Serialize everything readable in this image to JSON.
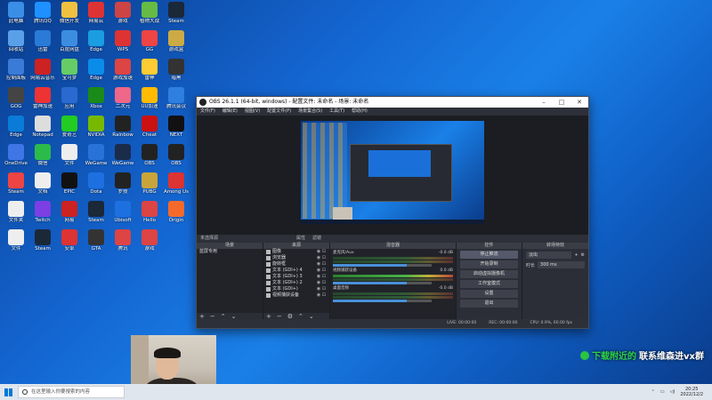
{
  "desktop_icons": [
    {
      "label": "此电脑",
      "color": "#3a8ee6"
    },
    {
      "label": "腾讯QQ",
      "color": "#1e90ff"
    },
    {
      "label": "微信开发",
      "color": "#f0c040"
    },
    {
      "label": "网易云",
      "color": "#d33"
    },
    {
      "label": "游戏",
      "color": "#c44"
    },
    {
      "label": "植物大战",
      "color": "#6b4"
    },
    {
      "label": "Steam",
      "color": "#1b2838"
    },
    {
      "label": "回收站",
      "color": "#5aa0e8"
    },
    {
      "label": "迅雷",
      "color": "#2a7ad8"
    },
    {
      "label": "百度网盘",
      "color": "#3c8de0"
    },
    {
      "label": "Edge",
      "color": "#1b9de2"
    },
    {
      "label": "WPS",
      "color": "#d33"
    },
    {
      "label": "GG",
      "color": "#e44"
    },
    {
      "label": "游戏盒",
      "color": "#ca4"
    },
    {
      "label": "控制面板",
      "color": "#3b7bd8"
    },
    {
      "label": "网易云音乐",
      "color": "#c22"
    },
    {
      "label": "宝可梦",
      "color": "#6c6"
    },
    {
      "label": "Edge",
      "color": "#0c8ce9"
    },
    {
      "label": "游戏加速",
      "color": "#d44"
    },
    {
      "label": "雷神",
      "color": "#fc3"
    },
    {
      "label": "暗黑",
      "color": "#333"
    },
    {
      "label": "GOG",
      "color": "#444"
    },
    {
      "label": "雷神加速",
      "color": "#e33"
    },
    {
      "label": "应用",
      "color": "#2a6ad0"
    },
    {
      "label": "Xbox",
      "color": "#1a8a1a"
    },
    {
      "label": "二次元",
      "color": "#e68"
    },
    {
      "label": "UU加速",
      "color": "#fb0"
    },
    {
      "label": "腾讯会议",
      "color": "#2f7fe0"
    },
    {
      "label": "Edge",
      "color": "#0b7bd8"
    },
    {
      "label": "Notepad",
      "color": "#ddd"
    },
    {
      "label": "爱奇艺",
      "color": "#2c2"
    },
    {
      "label": "NVIDIA",
      "color": "#76b900"
    },
    {
      "label": "Rainbow",
      "color": "#222"
    },
    {
      "label": "Cheat",
      "color": "#c11"
    },
    {
      "label": "NEXT",
      "color": "#111"
    },
    {
      "label": "OneDrive",
      "color": "#3f76e6"
    },
    {
      "label": "微信",
      "color": "#2bbb4a"
    },
    {
      "label": "文件",
      "color": "#eee"
    },
    {
      "label": "WeGame",
      "color": "#2872d8"
    },
    {
      "label": "WeGame",
      "color": "#1b2b4a"
    },
    {
      "label": "OBS",
      "color": "#222"
    },
    {
      "label": "OBS",
      "color": "#222"
    },
    {
      "label": "Steam",
      "color": "#e44"
    },
    {
      "label": "文档",
      "color": "#eee"
    },
    {
      "label": "EPIC",
      "color": "#111"
    },
    {
      "label": "Dota",
      "color": "#1e70e0"
    },
    {
      "label": "罗技",
      "color": "#222"
    },
    {
      "label": "PUBG",
      "color": "#c9a43a"
    },
    {
      "label": "Among Us",
      "color": "#d33"
    },
    {
      "label": "文件夹",
      "color": "#eee"
    },
    {
      "label": "Twitch",
      "color": "#7b3fe4"
    },
    {
      "label": "网易",
      "color": "#c22"
    },
    {
      "label": "Steam",
      "color": "#1b2838"
    },
    {
      "label": "Ubisoft",
      "color": "#1e70e0"
    },
    {
      "label": "Hello",
      "color": "#d44"
    },
    {
      "label": "Origin",
      "color": "#f56a2a"
    },
    {
      "label": "文件",
      "color": "#eee"
    },
    {
      "label": "Steam",
      "color": "#1b2838"
    },
    {
      "label": "安卓",
      "color": "#d33"
    },
    {
      "label": "GTA",
      "color": "#333"
    },
    {
      "label": "腾讯",
      "color": "#d44"
    },
    {
      "label": "游戏",
      "color": "#d44"
    }
  ],
  "obs": {
    "title": "OBS 26.1.1 (64-bit, windows) - 配置文件: 未命名 - 场景: 未命名",
    "menu": [
      "文件(F)",
      "编辑(E)",
      "视图(V)",
      "配置文件(P)",
      "场景集合(S)",
      "工具(T)",
      "帮助(H)"
    ],
    "scene_bar": {
      "label": "未选择源",
      "filter1": "属性",
      "filter2": "滤镜"
    },
    "docks": {
      "scenes": {
        "title": "场景",
        "items": [
          "蓝屏专用"
        ]
      },
      "sources": {
        "title": "来源",
        "items": [
          "图像",
          "浏览器",
          "旋转框",
          "文本 (GDI+) 4",
          "文本 (GDI+) 3",
          "文本 (GDI+) 2",
          "文本 (GDI+)",
          "视频捕获设备"
        ]
      },
      "mixer": {
        "title": "混音器",
        "channels": [
          {
            "name": "麦克风/Aux",
            "db": "-0.0 dB"
          },
          {
            "name": "视频捕获设备",
            "db": "0.0 dB"
          },
          {
            "name": "桌面音频",
            "db": "-0.0 dB"
          }
        ]
      },
      "controls": {
        "title": "控件",
        "buttons": [
          "停止推流",
          "开始录制",
          "启动虚拟摄像机",
          "工作室模式",
          "设置",
          "退出"
        ]
      },
      "transitions": {
        "title": "转场特效",
        "selected": "淡出",
        "duration_label": "时长",
        "duration": "300 ms"
      }
    },
    "status": {
      "live": "LIVE: 00:00:00",
      "rec": "REC: 00:00:00",
      "cpu": "CPU: 0.9%, 60.00 fps"
    }
  },
  "overlay_text": {
    "part1": "下载附近的",
    "part2": "联系维森进vx群"
  },
  "taskbar": {
    "search_placeholder": "在这里输入你要搜索的内容",
    "time": "20:25",
    "date": "2022/12/2"
  }
}
